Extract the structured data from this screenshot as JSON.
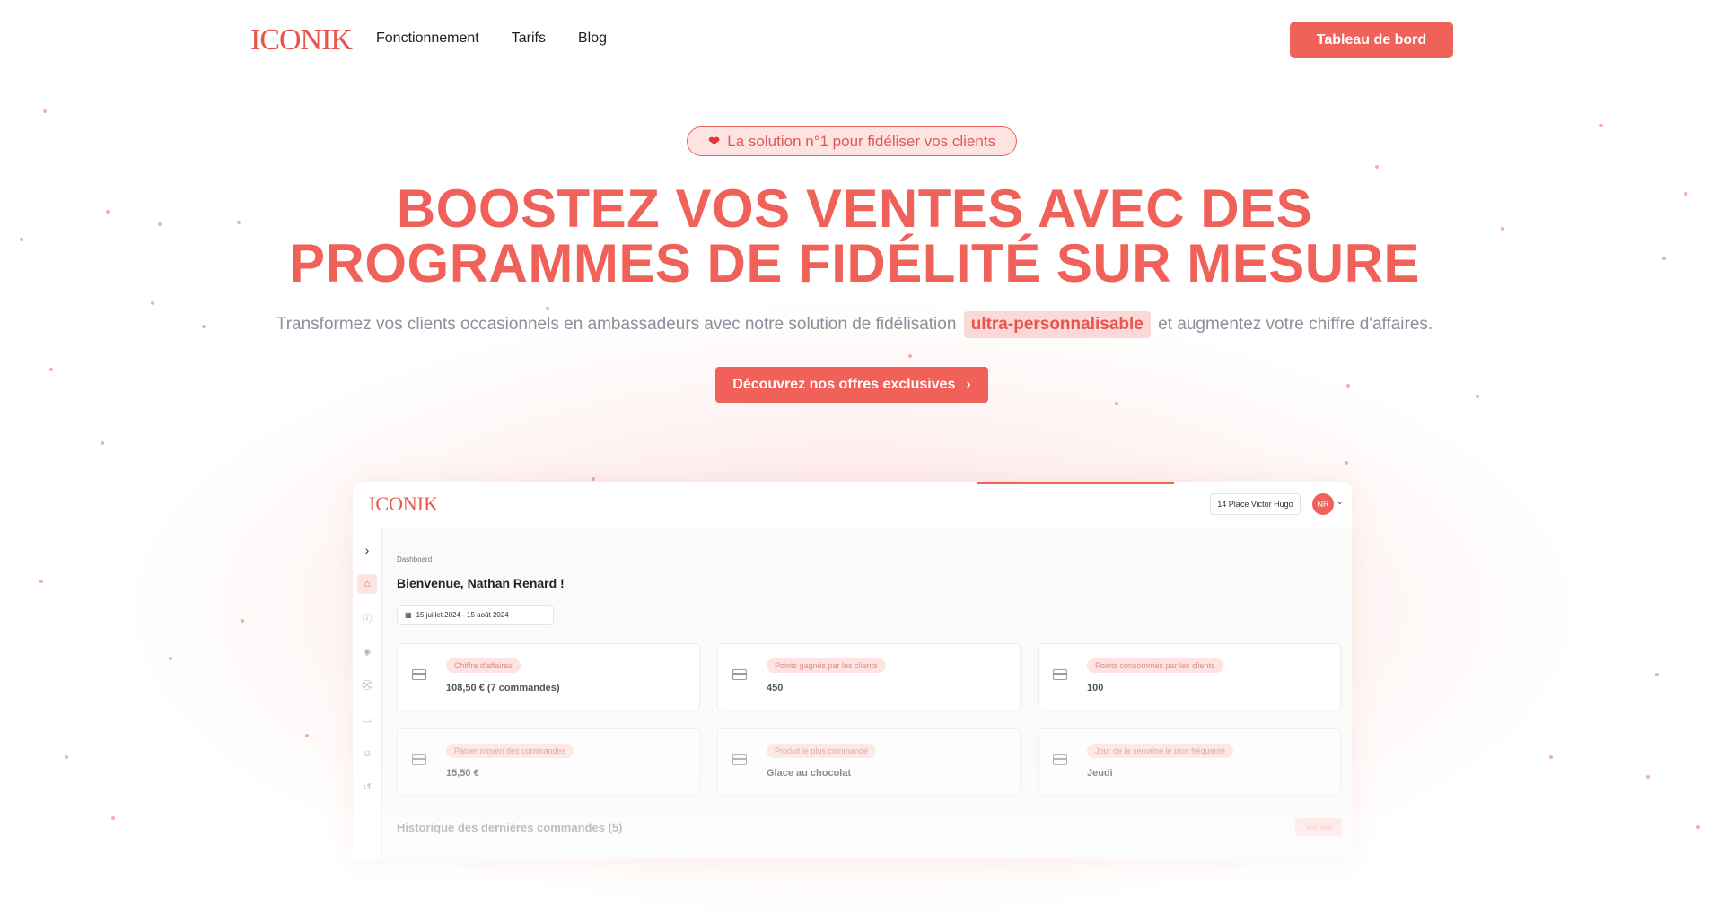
{
  "nav": {
    "logo": "ICONIK",
    "links": [
      "Fonctionnement",
      "Tarifs",
      "Blog"
    ],
    "cta": "Tableau de bord"
  },
  "hero": {
    "badge_icon": "heart-icon",
    "badge": "La solution n°1 pour fidéliser vos clients",
    "title_line1": "BOOSTEZ VOS VENTES AVEC DES",
    "title_line2": "PROGRAMMES DE FIDÉLITÉ SUR MESURE",
    "subtitle_before": "Transformez vos clients occasionnels en ambassadeurs avec notre solution de fidélisation",
    "subtitle_highlight": "ultra-personnalisable",
    "subtitle_after": "et augmentez votre chiffre d'affaires.",
    "cta": "Découvrez nos offres exclusives",
    "cta_icon": "chevron-right-icon"
  },
  "colors": {
    "accent": "#ef6159",
    "accent_light": "#fde3e1",
    "muted_text": "#8a8f9a"
  },
  "dashboard": {
    "logo": "ICONIK",
    "address": "14 Place Victor Hugo",
    "avatar": "NR",
    "breadcrumb": "Dashboard",
    "welcome": "Bienvenue, Nathan Renard !",
    "date_range": "15 juillet 2024 - 15 août 2024",
    "sidebar_icons": [
      "chevron-right-icon",
      "home-icon",
      "info-icon",
      "box-icon",
      "cart-icon",
      "ticket-icon",
      "users-icon",
      "history-icon"
    ],
    "cards": [
      {
        "label": "Chiffre d'affaires",
        "value": "108,50 € (7 commandes)"
      },
      {
        "label": "Points gagnés par les clients",
        "value": "450"
      },
      {
        "label": "Points consommés par les clients",
        "value": "100"
      },
      {
        "label": "Panier moyen des commandes",
        "value": "15,50 €"
      },
      {
        "label": "Produit le plus commandé",
        "value": "Glace au chocolat"
      },
      {
        "label": "Jour de la semaine le plus fréquenté",
        "value": "Jeudi"
      }
    ],
    "history_title": "Historique des dernières commandes (5)",
    "history_button": "Voir tout"
  }
}
